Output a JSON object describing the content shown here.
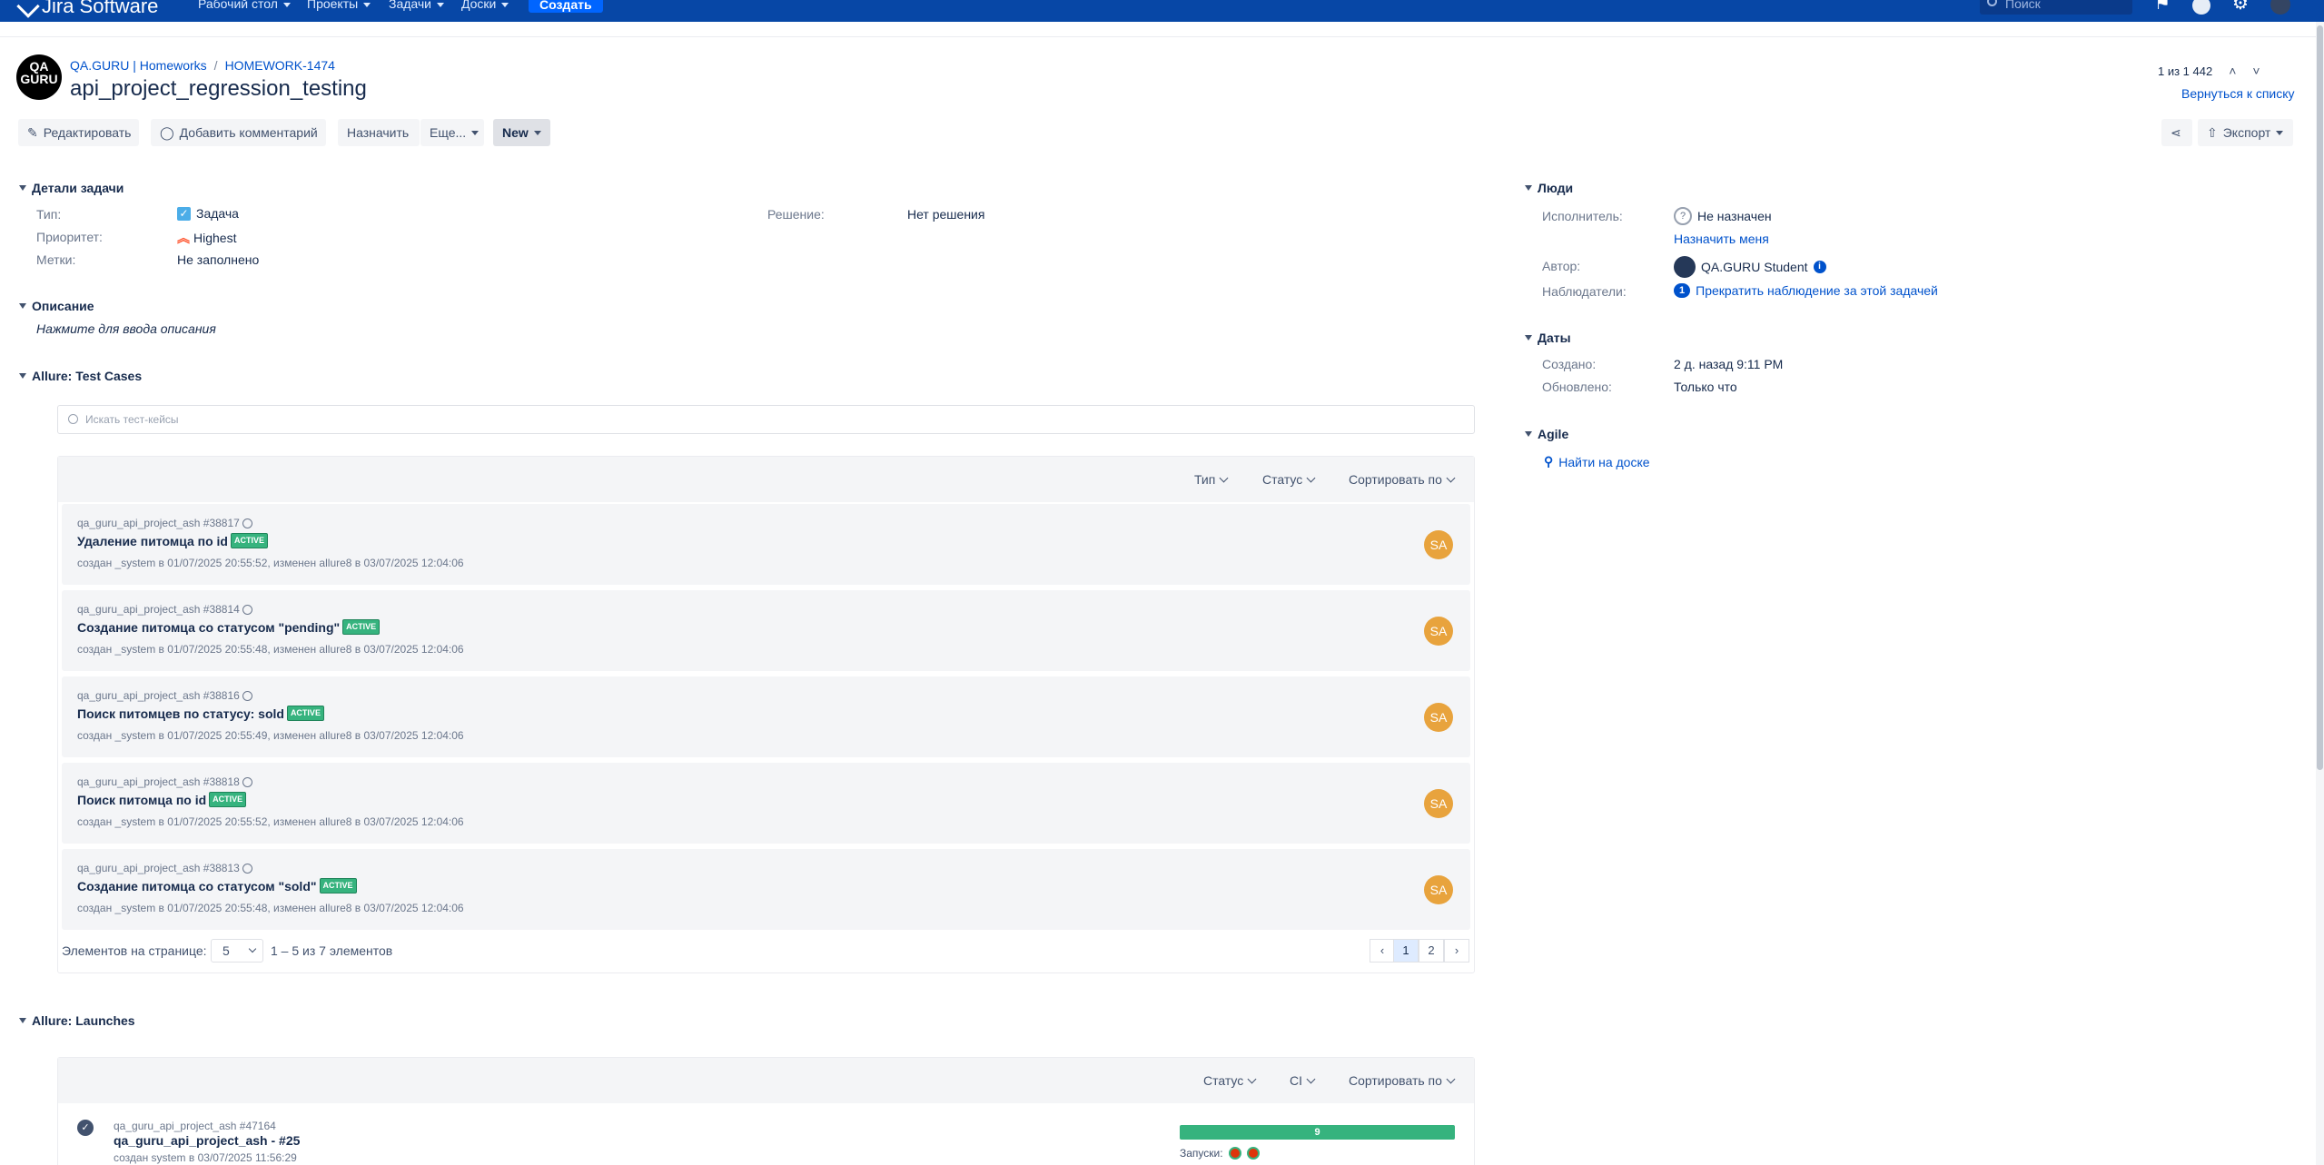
{
  "nav": {
    "brand": "Jira Software",
    "menu": [
      "Рабочий стол",
      "Проекты",
      "Задачи",
      "Доски"
    ],
    "create_label": "Создать",
    "search_placeholder": "Поиск"
  },
  "header": {
    "project_avatar_text": "QA GURU",
    "breadcrumb_project": "QA.GURU | Homeworks",
    "breadcrumb_sep": "/",
    "breadcrumb_issue": "HOMEWORK-1474",
    "title": "api_project_regression_testing",
    "pager_text": "1 из 1 442",
    "back_to_list": "Вернуться к списку"
  },
  "toolbar": {
    "edit": "Редактировать",
    "comment": "Добавить комментарий",
    "assign": "Назначить",
    "more": "Еще...",
    "status": "New",
    "share_icon": "share-icon",
    "export": "Экспорт"
  },
  "details": {
    "heading": "Детали задачи",
    "type_label": "Тип:",
    "type_value": "Задача",
    "priority_label": "Приоритет:",
    "priority_value": "Highest",
    "labels_label": "Метки:",
    "labels_value": "Не заполнено",
    "resolution_label": "Решение:",
    "resolution_value": "Нет решения"
  },
  "description": {
    "heading": "Описание",
    "placeholder": "Нажмите для ввода описания"
  },
  "test_cases": {
    "heading": "Allure: Test Cases",
    "search_placeholder": "Искать тест-кейсы",
    "filter_type": "Тип",
    "filter_status": "Статус",
    "filter_sort": "Сортировать по",
    "rows": [
      {
        "meta": "qa_guru_api_project_ash #38817",
        "name": "Удаление питомца по id",
        "badge": "ACTIVE",
        "info": "создан _system в 01/07/2025 20:55:52, изменен allure8 в 03/07/2025 12:04:06",
        "avatar": "SA"
      },
      {
        "meta": "qa_guru_api_project_ash #38814",
        "name": "Создание питомца со статусом \"pending\"",
        "badge": "ACTIVE",
        "info": "создан _system в 01/07/2025 20:55:48, изменен allure8 в 03/07/2025 12:04:06",
        "avatar": "SA"
      },
      {
        "meta": "qa_guru_api_project_ash #38816",
        "name": "Поиск питомцев по статусу: sold",
        "badge": "ACTIVE",
        "info": "создан _system в 01/07/2025 20:55:49, изменен allure8 в 03/07/2025 12:04:06",
        "avatar": "SA"
      },
      {
        "meta": "qa_guru_api_project_ash #38818",
        "name": "Поиск питомца по id",
        "badge": "ACTIVE",
        "info": "создан _system в 01/07/2025 20:55:52, изменен allure8 в 03/07/2025 12:04:06",
        "avatar": "SA"
      },
      {
        "meta": "qa_guru_api_project_ash #38813",
        "name": "Создание питомца со статусом \"sold\"",
        "badge": "ACTIVE",
        "info": "создан _system в 01/07/2025 20:55:48, изменен allure8 в 03/07/2025 12:04:06",
        "avatar": "SA"
      }
    ],
    "per_page_label": "Элементов на странице:",
    "per_page_value": "5",
    "range_text": "1 – 5 из 7 элементов",
    "pages": [
      "1",
      "2"
    ]
  },
  "launches": {
    "heading": "Allure: Launches",
    "filter_status": "Статус",
    "filter_ci": "CI",
    "filter_sort": "Сортировать по",
    "item": {
      "meta": "qa_guru_api_project_ash #47164",
      "name": "qa_guru_api_project_ash - #25",
      "info": "создан system в 03/07/2025 11:56:29",
      "passed": "9",
      "runs_label": "Запуски:"
    }
  },
  "people": {
    "heading": "Люди",
    "assignee_label": "Исполнитель:",
    "assignee_value": "Не назначен",
    "assign_me": "Назначить меня",
    "reporter_label": "Автор:",
    "reporter_value": "QA.GURU Student",
    "watchers_label": "Наблюдатели:",
    "watchers_count": "1",
    "watchers_action": "Прекратить наблюдение за этой задачей"
  },
  "dates": {
    "heading": "Даты",
    "created_label": "Создано:",
    "created_value": "2 д. назад 9:11 PM",
    "updated_label": "Обновлено:",
    "updated_value": "Только что"
  },
  "agile": {
    "heading": "Agile",
    "find_on_board": "Найти на доске"
  }
}
